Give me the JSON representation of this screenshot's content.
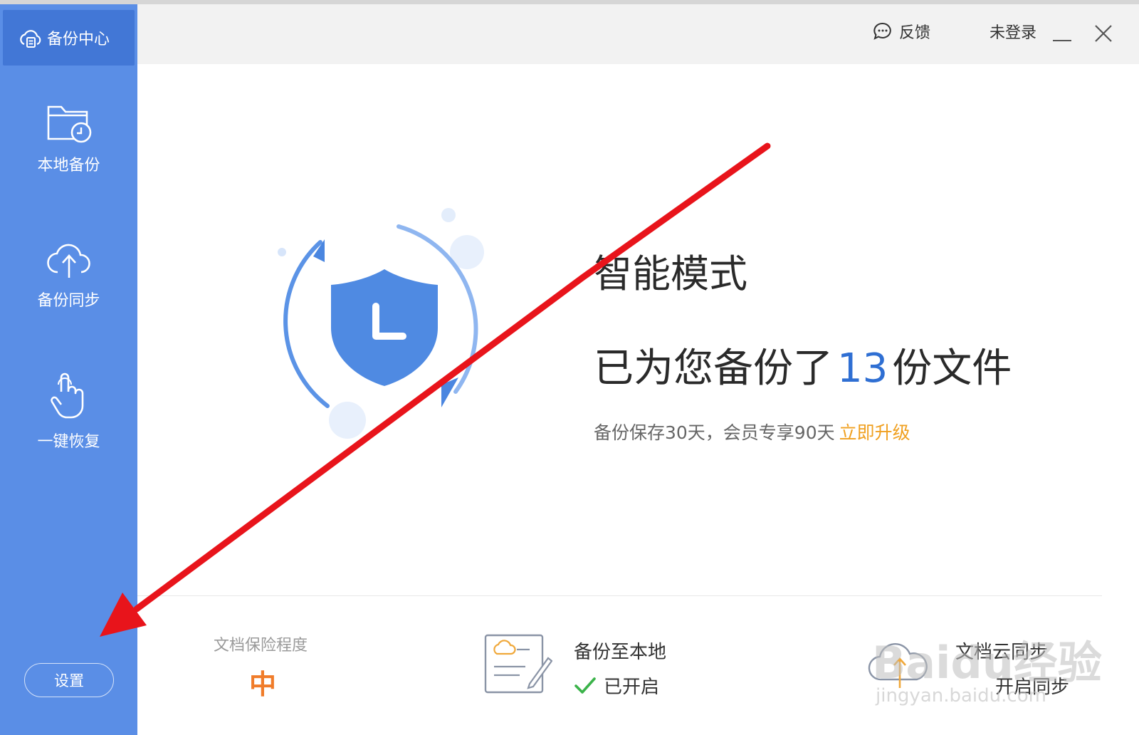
{
  "sidebar": {
    "brand_label": "备份中心",
    "items": [
      {
        "label": "本地备份",
        "icon": "folder-clock-icon"
      },
      {
        "label": "备份同步",
        "icon": "cloud-upload-icon"
      },
      {
        "label": "一键恢复",
        "icon": "hand-pointer-icon"
      }
    ],
    "settings_label": "设置"
  },
  "header": {
    "feedback_label": "反馈",
    "login_label": "未登录"
  },
  "main": {
    "mode_title": "智能模式",
    "backup_prefix": "已为您备份了",
    "backup_count": "13",
    "backup_suffix": "份文件",
    "retention_text": "备份保存30天，会员专享90天",
    "upgrade_link": "立即升级"
  },
  "footer": {
    "protection_label": "文档保险程度",
    "protection_level": "中",
    "local_backup_title": "备份至本地",
    "local_backup_status": "已开启",
    "cloud_sync_title": "文档云同步",
    "cloud_sync_action": "开启同步"
  },
  "watermark": {
    "brand": "Baidu经验",
    "url": "jingyan.baidu.com"
  },
  "colors": {
    "sidebar": "#5a8ee6",
    "accent": "#2f6fd3",
    "upgrade": "#f0a020",
    "level": "#f07c2a",
    "arrow": "#e8141b"
  }
}
